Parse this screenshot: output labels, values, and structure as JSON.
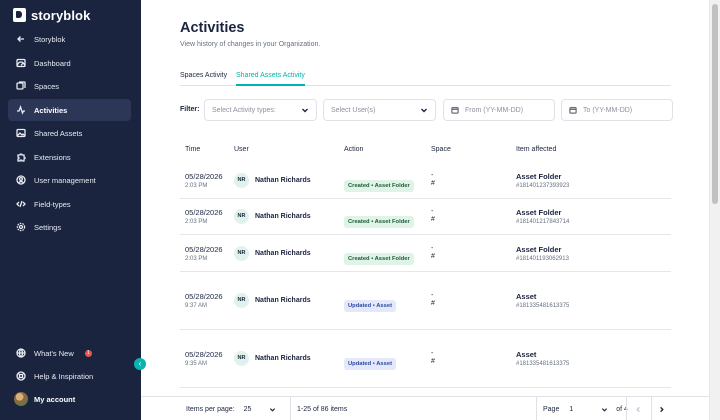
{
  "sidebar": {
    "logo_text": "storyblok",
    "items": [
      {
        "label": "Storyblok",
        "icon": "arrow-left-icon"
      },
      {
        "label": "Dashboard",
        "icon": "dashboard-icon"
      },
      {
        "label": "Spaces",
        "icon": "layers-icon"
      },
      {
        "label": "Activities",
        "icon": "activity-icon",
        "active": true
      },
      {
        "label": "Shared Assets",
        "icon": "image-icon"
      },
      {
        "label": "Extensions",
        "icon": "puzzle-icon"
      },
      {
        "label": "User management",
        "icon": "user-circle-icon"
      },
      {
        "label": "Field-types",
        "icon": "code-icon"
      },
      {
        "label": "Settings",
        "icon": "gear-icon"
      }
    ],
    "bottom": {
      "whats_new": "What's New",
      "whats_new_badge": "1",
      "help": "Help & Inspiration",
      "account": "My account"
    }
  },
  "page": {
    "title": "Activities",
    "subtitle": "View history of changes in your Organization."
  },
  "tabs": [
    {
      "label": "Spaces Activity",
      "active": false
    },
    {
      "label": "Shared Assets Activity",
      "active": true
    }
  ],
  "filter": {
    "label": "Filter:",
    "activity_types_placeholder": "Select Activity types:",
    "users_placeholder": "Select User(s)",
    "from_placeholder": "From (YY-MM-DD)",
    "to_placeholder": "To (YY-MM-DD)"
  },
  "table": {
    "columns": [
      "Time",
      "User",
      "Action",
      "Space",
      "Item affected"
    ],
    "rows": [
      {
        "date": "05/28/2026",
        "time": "2:03 PM",
        "initials": "NR",
        "user": "Nathan Richards",
        "action": "Created • Asset Folder",
        "action_type": "created",
        "space_name": "-",
        "space_id": "#",
        "item": "Asset Folder",
        "item_id": "#181401237393923"
      },
      {
        "date": "05/28/2026",
        "time": "2:03 PM",
        "initials": "NR",
        "user": "Nathan Richards",
        "action": "Created • Asset Folder",
        "action_type": "created",
        "space_name": "-",
        "space_id": "#",
        "item": "Asset Folder",
        "item_id": "#181401217843714"
      },
      {
        "date": "05/28/2026",
        "time": "2:03 PM",
        "initials": "NR",
        "user": "Nathan Richards",
        "action": "Created • Asset Folder",
        "action_type": "created",
        "space_name": "-",
        "space_id": "#",
        "item": "Asset Folder",
        "item_id": "#181401193062913"
      },
      {
        "date": "05/28/2026",
        "time": "9:37 AM",
        "initials": "NR",
        "user": "Nathan Richards",
        "action": "Updated • Asset",
        "action_type": "updated",
        "space_name": "-",
        "space_id": "#",
        "item": "Asset",
        "item_id": "#181335481613375"
      },
      {
        "date": "05/28/2026",
        "time": "9:35 AM",
        "initials": "NR",
        "user": "Nathan Richards",
        "action": "Updated • Asset",
        "action_type": "updated",
        "space_name": "-",
        "space_id": "#",
        "item": "Asset",
        "item_id": "#181335481613375"
      }
    ]
  },
  "footer": {
    "items_per_page_label": "Items per page:",
    "items_per_page_value": "25",
    "range": "1-25 of 86 items",
    "page_label": "Page",
    "page_value": "1",
    "page_total": "of 4"
  },
  "colors": {
    "sidebar_bg": "#1b243f",
    "accent": "#00b3b0",
    "created_tag_bg": "#dff3e7",
    "updated_tag_bg": "#e3e9fb"
  }
}
